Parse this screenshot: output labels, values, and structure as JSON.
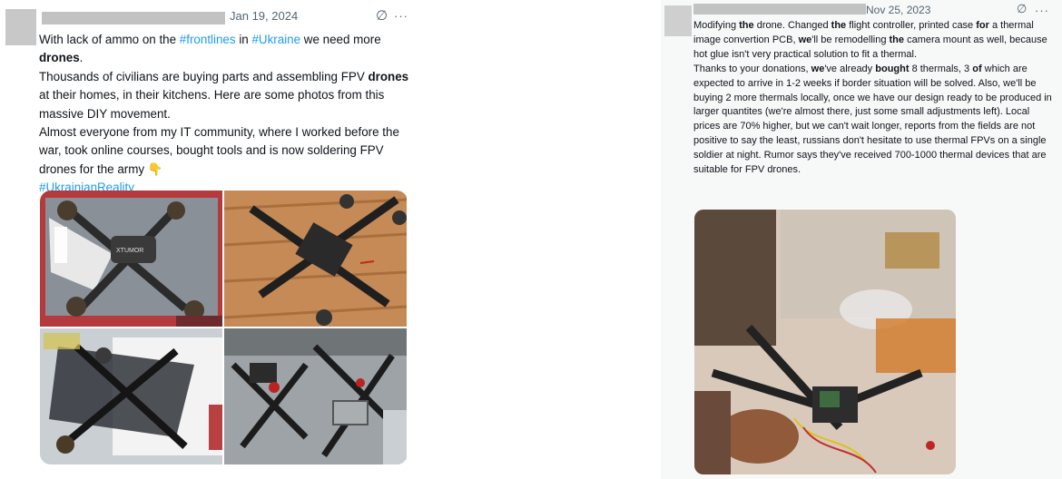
{
  "tweets": [
    {
      "date": "Jan 19, 2024",
      "grok_icon": "∅",
      "more_icon": "···",
      "body": {
        "l1a": "With lack of ammo on the ",
        "tag1": "#frontlines",
        "l1b": " in ",
        "tag2": "#Ukraine",
        "l1c": " we need more ",
        "b1": "drones",
        "l1d": ".",
        "l2a": "Thousands of civilians are buying parts and assembling FPV ",
        "b2": "drones",
        "l2b": " at their homes, in their kitchens. Here are some photos from this massive DIY movement.",
        "l3": "Almost everyone from my IT community, where I worked before the war, took online courses, bought tools and is now soldering FPV drones for the army",
        "emoji": "👇",
        "tag3": "#UkrainianReality"
      },
      "photos": [
        {
          "name": "drone-frame-on-box-photo",
          "logo_text": "XTUMOR"
        },
        {
          "name": "drone-frame-on-table-photo"
        },
        {
          "name": "drone-parts-packaging-photo"
        },
        {
          "name": "drones-on-workbench-photo"
        }
      ]
    },
    {
      "date": "Nov 25, 2023",
      "grok_icon": "∅",
      "more_icon": "···",
      "body": {
        "s1": "Modifying ",
        "b1": "the",
        "s2": " drone. Changed ",
        "b2": "the",
        "s3": " flight controller, printed case ",
        "b3": "for",
        "s4": " a thermal image convertion PCB, ",
        "b4": "we",
        "s5": "'ll be remodelling ",
        "b5": "the",
        "s6": " camera mount as well, because hot glue isn't very practical solution to fit a thermal.\nThanks to your donations, ",
        "b6": "we",
        "s7": "'ve already ",
        "b7": "bought",
        "s8": " 8 thermals, 3 ",
        "b8": "of",
        "s9": " which are expected to arrive in 1-2 weeks if border situation will be solved. Also, we'll be buying 2 more thermals locally, once we have our design ready to be produced in larger quantites (we're almost there, just some small adjustments left). Local prices are 70% higher, but we can't wait longer, reports from the fields are not positive to say the least, russians don't hesitate to use thermal FPVs on a single soldier at night. Rumor says they've received 700-1000 thermal devices that are suitable for FPV drones."
      },
      "photo": {
        "name": "drone-modification-photo"
      }
    }
  ]
}
